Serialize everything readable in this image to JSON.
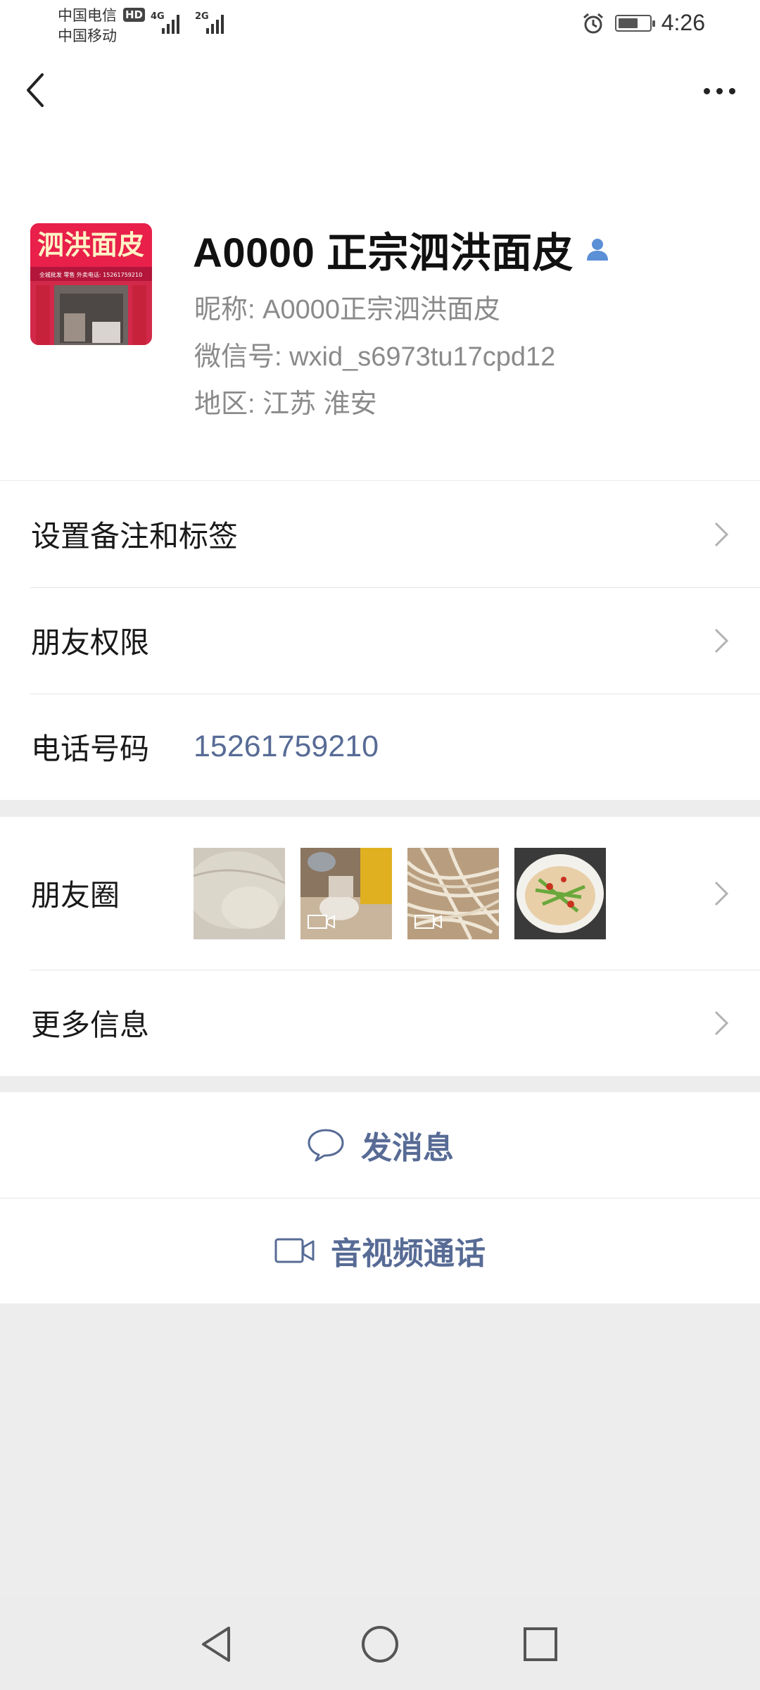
{
  "status_bar": {
    "carrier_1": "中国电信",
    "carrier_2": "中国移动",
    "hd": "HD",
    "net_1": "4G",
    "net_2": "2G",
    "time": "4:26",
    "battery_level": 0.65
  },
  "nav": {
    "back_icon": "chevron-left-icon",
    "more_icon": "ellipsis-icon"
  },
  "profile": {
    "name": "A0000 正宗泗洪面皮",
    "nickname": "昵称:  A0000正宗泗洪面皮",
    "wechat_id": "微信号:  wxid_s6973tu17cpd12",
    "region": "地区:  江苏  淮安",
    "avatar_sign": "泗洪面皮",
    "avatar_sub": "全城批发  零售   外卖电话: 15261759210",
    "accent_color": "#5b8fd6"
  },
  "cells": {
    "remark": "设置备注和标签",
    "permission": "朋友权限",
    "phone_label": "电话号码",
    "phone_value": "15261759210",
    "moments": "朋友圈",
    "more_info": "更多信息"
  },
  "actions": {
    "message": "发消息",
    "call": "音视频通话",
    "link_color": "#576b95"
  },
  "system_nav": {
    "back": "triangle-back-icon",
    "home": "circle-home-icon",
    "recents": "square-recents-icon"
  }
}
